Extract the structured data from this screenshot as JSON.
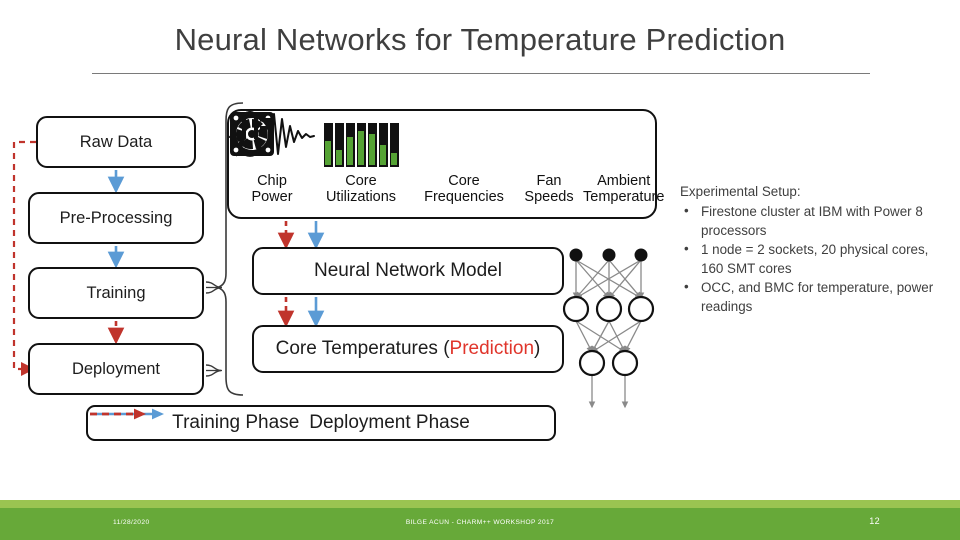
{
  "slide": {
    "title": "Neural Networks for Temperature Prediction"
  },
  "flow": {
    "left_boxes": [
      {
        "label": "Raw Data"
      },
      {
        "label": "Pre-Processing"
      },
      {
        "label": "Training"
      },
      {
        "label": "Deployment"
      }
    ],
    "model_box": "Neural Network Model",
    "output_box_prefix": "Core Temperatures (",
    "output_box_highlight": "Prediction",
    "output_box_suffix": ")"
  },
  "sensors": [
    {
      "icon": "lightning-bolt-icon",
      "line1": "Chip",
      "line2": "Power"
    },
    {
      "icon": "bar-levels-icon",
      "line1": "Core",
      "line2": "Utilizations"
    },
    {
      "icon": "waveform-icon",
      "line1": "Core",
      "line2": "Frequencies"
    },
    {
      "icon": "fan-icon",
      "line1": "Fan",
      "line2": "Speeds"
    },
    {
      "icon": "thermometer-icon",
      "line1": "Ambient",
      "line2": "Temperature"
    }
  ],
  "utilization_bars": [
    0.62,
    0.38,
    0.72,
    0.86,
    0.78,
    0.5,
    0.3
  ],
  "legend": {
    "training_phase": "Training Phase",
    "deployment_phase": "Deployment Phase"
  },
  "setup": {
    "heading": "Experimental Setup:",
    "bullet_glyph": "•",
    "items": [
      "Firestone cluster at IBM with Power 8 processors",
      "1 node = 2 sockets, 20 physical cores, 160 SMT cores",
      "OCC, and BMC for temperature, power readings"
    ]
  },
  "footer": {
    "date": "11/28/2020",
    "center": "BILGE ACUN - CHARM++ WORKSHOP 2017",
    "page": "12"
  },
  "colors": {
    "training_arrow": "#5b9bd5",
    "deployment_arrow": "#c0342c",
    "prediction_text": "#e0352b",
    "utilization_green": "#55a334",
    "footer_bar": "#67a939",
    "footer_accent": "#9ac451"
  }
}
